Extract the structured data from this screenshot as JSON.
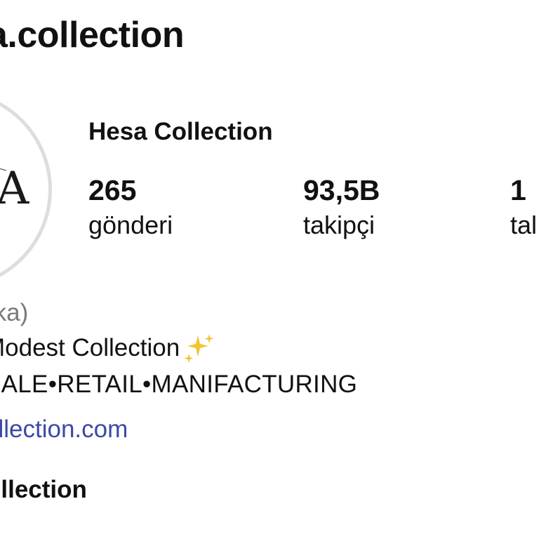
{
  "header": {
    "username": "a.collection"
  },
  "profile": {
    "avatar_letter": "A",
    "display_name": "Hesa Collection"
  },
  "stats": {
    "posts": {
      "value": "265",
      "label": "gönderi"
    },
    "followers": {
      "value": "93,5B",
      "label": "takipçi"
    },
    "following": {
      "value": "1",
      "label": "tal"
    }
  },
  "bio": {
    "category": "rka)",
    "tagline": "Modest Collection",
    "tagline_emoji": "sparkles-icon",
    "services": "SALE•RETAIL•MANIFACTURING",
    "link": "ollection.com",
    "name_line": "ollection"
  },
  "colors": {
    "link": "#3b49a6",
    "category_text": "#7a7a7a",
    "avatar_ring": "#dcdde0",
    "sparkle": "#f4c430"
  }
}
